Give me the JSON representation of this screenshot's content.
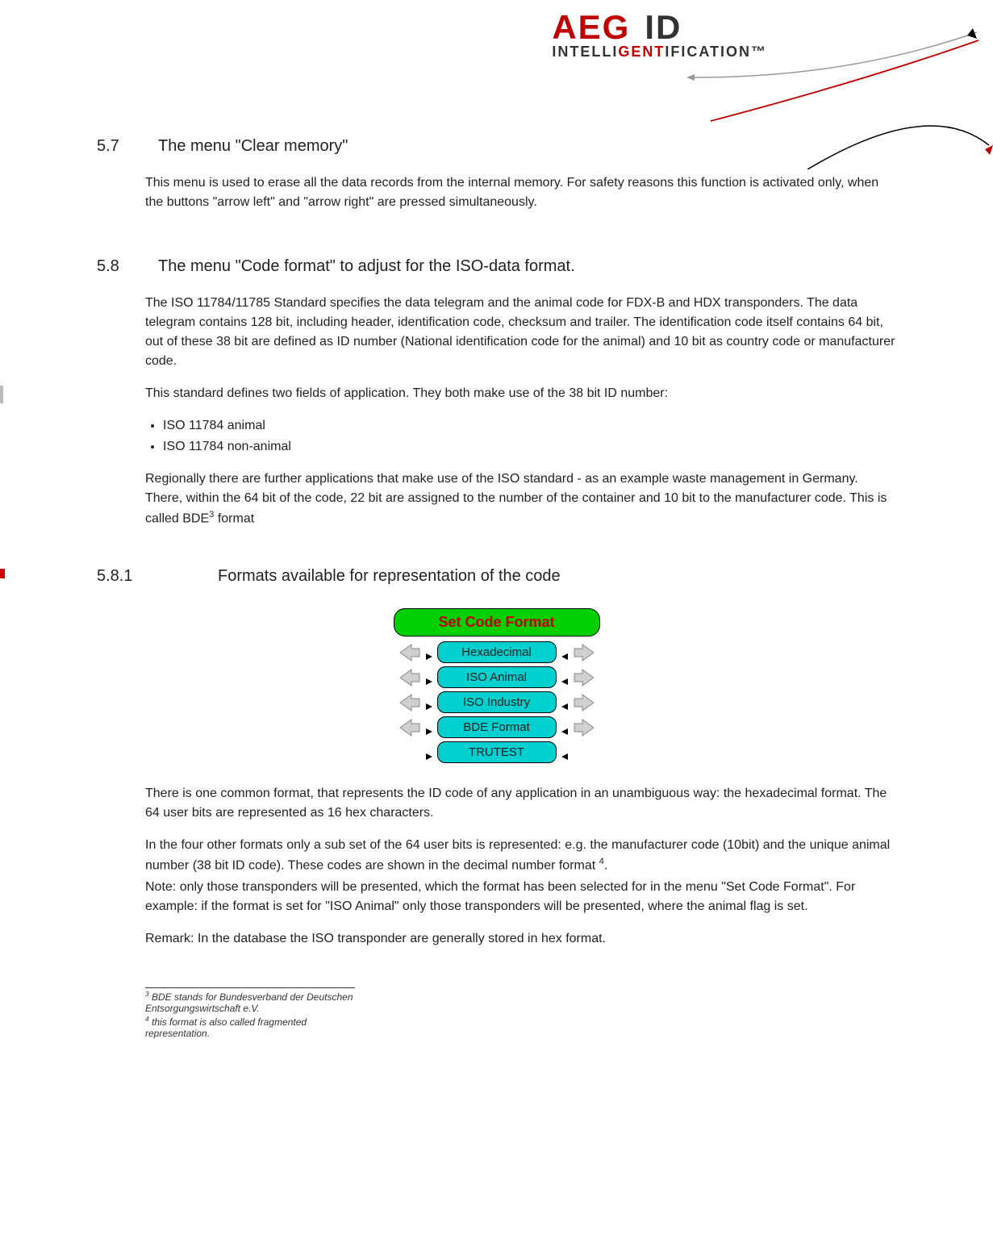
{
  "logo": {
    "brand": "AEG",
    "id": "ID",
    "tag_pre": "INTELLI",
    "tag_mid": "GENT",
    "tag_post": "IFICATION™"
  },
  "s57": {
    "num": "5.7",
    "title": "The menu \"Clear memory\"",
    "para1": "This menu is used to erase all the data records from the internal memory. For safety reasons this function is activated only, when the buttons \"arrow left\" and \"arrow right\" are pressed simultaneously."
  },
  "s58": {
    "num": "5.8",
    "title": "The menu \"Code format\" to adjust for the ISO-data format.",
    "para1": "The ISO 11784/11785 Standard specifies the data telegram and the animal code for FDX-B and HDX transponders. The data telegram contains 128 bit, including header, identification code, checksum and trailer. The identification code itself contains 64 bit, out of these 38 bit are defined as ID number (National identification code for the animal) and 10 bit as country code or manufacturer code.",
    "para2": "This standard defines two fields of application. They both make use of the 38 bit ID number:",
    "li1": "ISO 11784 animal",
    "li2": "ISO 11784 non-animal",
    "para3a": "Regionally there are further applications that make use of the ISO standard - as an example waste management in Germany. There, within the 64 bit of the code, 22 bit are assigned to the number of the container and 10 bit to the manufacturer code. This is called BDE",
    "sup3": "3",
    "para3b": " format"
  },
  "s581": {
    "num": "5.8.1",
    "title": "Formats available for representation of the code",
    "para1": "There is one common format, that represents the ID code of any application in an unambiguous way: the hexadecimal format. The 64 user bits are represented as 16 hex characters.",
    "para2a": "In the four other formats only a sub set of the 64 user bits is represented: e.g. the manufacturer code (10bit) and the unique animal number (38 bit ID code). These codes are shown in the decimal number format ",
    "sup4": "4",
    "para2b": ".",
    "para3": "Note: only those transponders will be presented, which the format has been selected for in the menu \"Set Code Format\". For example: if the format is set for \"ISO Animal\" only those transponders will be presented, where the animal flag is set.",
    "para4": "Remark: In the database the ISO transponder are generally stored in hex format."
  },
  "diagram": {
    "header": "Set Code Format",
    "items": [
      "Hexadecimal",
      "ISO Animal",
      "ISO Industry",
      "BDE Format",
      "TRUTEST"
    ]
  },
  "footnotes": {
    "f3_sup": "3",
    "f3": " BDE stands for  Bundesverband der Deutschen Entsorgungswirtschaft e.V.",
    "f4_sup": "4",
    "f4": " this format is also called fragmented representation."
  }
}
